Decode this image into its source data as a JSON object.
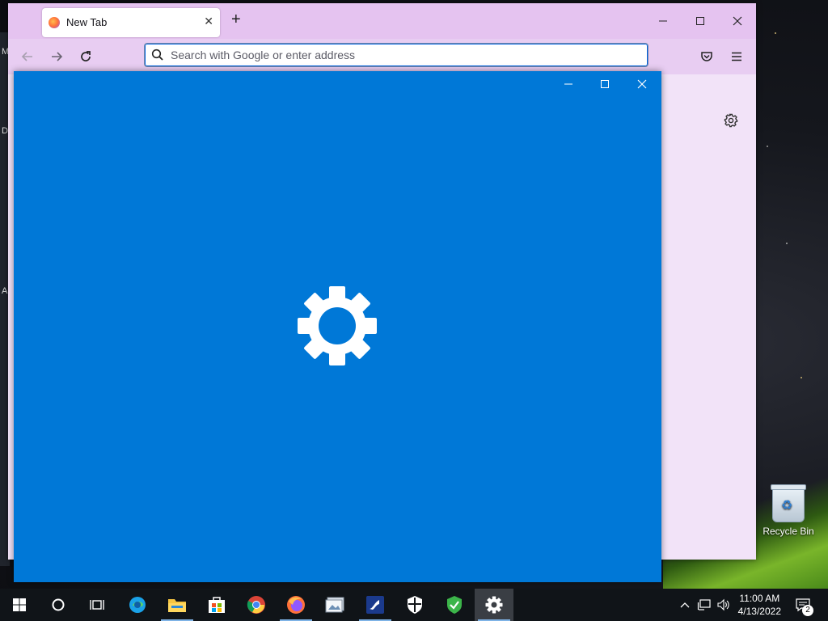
{
  "desktop": {
    "edge_letters": [
      "M",
      "D",
      "A"
    ],
    "recycle_bin_label": "Recycle Bin"
  },
  "firefox": {
    "tab_title": "New Tab",
    "new_tab_symbol": "+",
    "url_placeholder": "Search with Google or enter address",
    "back_icon": "arrow-left-icon",
    "forward_icon": "arrow-right-icon",
    "reload_icon": "reload-icon",
    "pocket_icon": "pocket-icon",
    "menu_icon": "hamburger-menu-icon",
    "settings_icon": "gear-icon",
    "theme_color": "#e5c3f0"
  },
  "settings_window": {
    "background_color": "#0078d7",
    "splash_icon": "gear-icon"
  },
  "taskbar": {
    "apps": [
      "start",
      "cortana-search",
      "task-view",
      "edge",
      "file-explorer",
      "microsoft-store",
      "chrome",
      "firefox",
      "image-viewer",
      "app-installer",
      "windows-security",
      "shield-app",
      "settings"
    ],
    "clock_time": "11:00 AM",
    "clock_date": "4/13/2022",
    "notification_count": "2"
  }
}
